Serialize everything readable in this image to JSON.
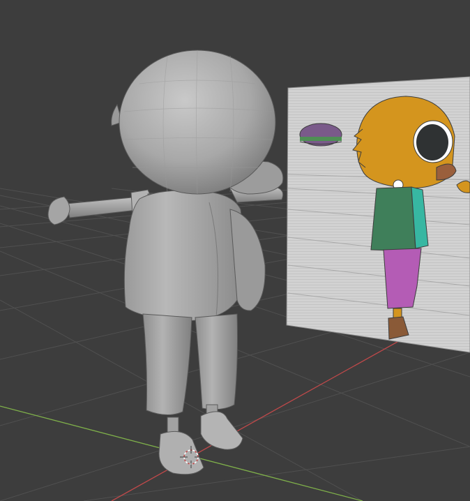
{
  "app": {
    "title": ""
  },
  "viewport": {
    "mode": "solid-shading",
    "grid_visible": true,
    "axis_colors": {
      "x_axis": "#c0494a",
      "y_axis": "#7fb04a"
    },
    "background": "#3d3d3d"
  },
  "scene": {
    "model": {
      "name": "",
      "material": "grey-clay"
    },
    "reference_image": {
      "colors": {
        "head": "#d4951e",
        "eye": "#2f3233",
        "beak": "#9a5f3c",
        "shirt": "#3f7f5a",
        "sleeve": "#37b7a2",
        "pants": "#b45cb5",
        "shoe": "#8a5a37",
        "hat": "#7a5a8a",
        "hat_band": "#4f8f55"
      }
    },
    "cursor_icon": "3d-cursor-icon"
  }
}
